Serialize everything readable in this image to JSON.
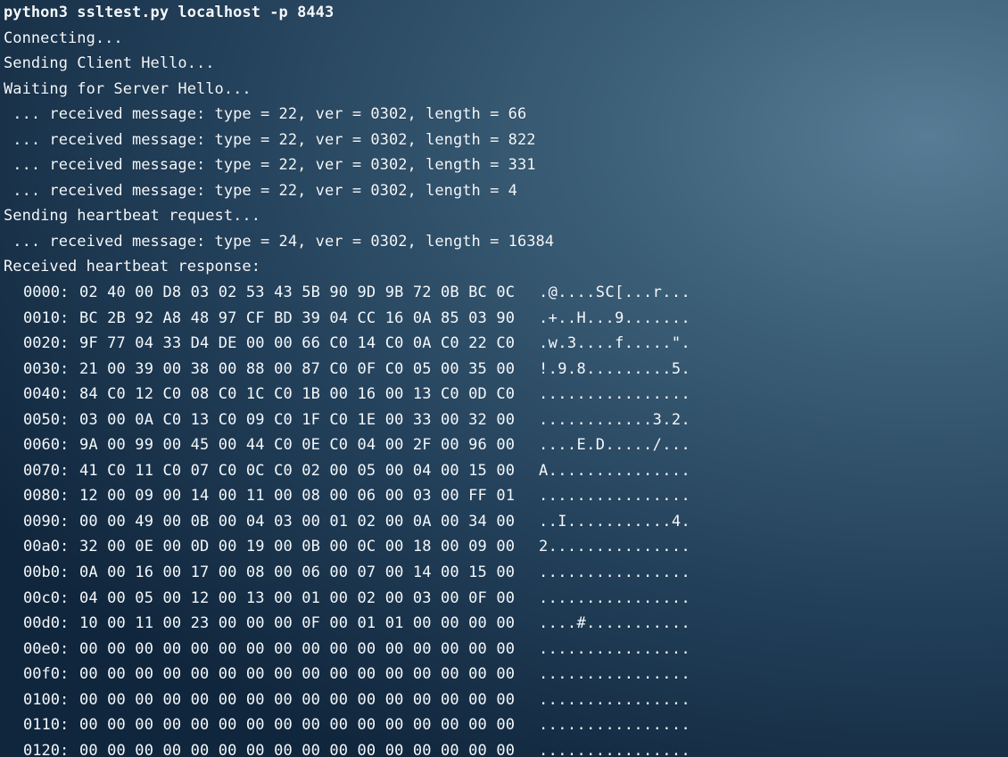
{
  "terminal": {
    "lines": [
      "python3 ssltest.py localhost -p 8443",
      "Connecting...",
      "Sending Client Hello...",
      "Waiting for Server Hello...",
      " ... received message: type = 22, ver = 0302, length = 66",
      " ... received message: type = 22, ver = 0302, length = 822",
      " ... received message: type = 22, ver = 0302, length = 331",
      " ... received message: type = 22, ver = 0302, length = 4",
      "Sending heartbeat request...",
      " ... received message: type = 24, ver = 0302, length = 16384",
      "Received heartbeat response:"
    ],
    "dump": [
      {
        "offset": "0000:",
        "hex": "02 40 00 D8 03 02 53 43 5B 90 9D 9B 72 0B BC 0C",
        "ascii": ".@....SC[...r..."
      },
      {
        "offset": "0010:",
        "hex": "BC 2B 92 A8 48 97 CF BD 39 04 CC 16 0A 85 03 90",
        "ascii": ".+..H...9......."
      },
      {
        "offset": "0020:",
        "hex": "9F 77 04 33 D4 DE 00 00 66 C0 14 C0 0A C0 22 C0",
        "ascii": ".w.3....f.....\"."
      },
      {
        "offset": "0030:",
        "hex": "21 00 39 00 38 00 88 00 87 C0 0F C0 05 00 35 00",
        "ascii": "!.9.8.........5."
      },
      {
        "offset": "0040:",
        "hex": "84 C0 12 C0 08 C0 1C C0 1B 00 16 00 13 C0 0D C0",
        "ascii": "................"
      },
      {
        "offset": "0050:",
        "hex": "03 00 0A C0 13 C0 09 C0 1F C0 1E 00 33 00 32 00",
        "ascii": "............3.2."
      },
      {
        "offset": "0060:",
        "hex": "9A 00 99 00 45 00 44 C0 0E C0 04 00 2F 00 96 00",
        "ascii": "....E.D...../..."
      },
      {
        "offset": "0070:",
        "hex": "41 C0 11 C0 07 C0 0C C0 02 00 05 00 04 00 15 00",
        "ascii": "A..............."
      },
      {
        "offset": "0080:",
        "hex": "12 00 09 00 14 00 11 00 08 00 06 00 03 00 FF 01",
        "ascii": "................"
      },
      {
        "offset": "0090:",
        "hex": "00 00 49 00 0B 00 04 03 00 01 02 00 0A 00 34 00",
        "ascii": "..I...........4."
      },
      {
        "offset": "00a0:",
        "hex": "32 00 0E 00 0D 00 19 00 0B 00 0C 00 18 00 09 00",
        "ascii": "2..............."
      },
      {
        "offset": "00b0:",
        "hex": "0A 00 16 00 17 00 08 00 06 00 07 00 14 00 15 00",
        "ascii": "................"
      },
      {
        "offset": "00c0:",
        "hex": "04 00 05 00 12 00 13 00 01 00 02 00 03 00 0F 00",
        "ascii": "................"
      },
      {
        "offset": "00d0:",
        "hex": "10 00 11 00 23 00 00 00 0F 00 01 01 00 00 00 00",
        "ascii": "....#..........."
      },
      {
        "offset": "00e0:",
        "hex": "00 00 00 00 00 00 00 00 00 00 00 00 00 00 00 00",
        "ascii": "................"
      },
      {
        "offset": "00f0:",
        "hex": "00 00 00 00 00 00 00 00 00 00 00 00 00 00 00 00",
        "ascii": "................"
      },
      {
        "offset": "0100:",
        "hex": "00 00 00 00 00 00 00 00 00 00 00 00 00 00 00 00",
        "ascii": "................"
      },
      {
        "offset": "0110:",
        "hex": "00 00 00 00 00 00 00 00 00 00 00 00 00 00 00 00",
        "ascii": "................"
      },
      {
        "offset": "0120:",
        "hex": "00 00 00 00 00 00 00 00 00 00 00 00 00 00 00 00",
        "ascii": "................"
      }
    ]
  }
}
